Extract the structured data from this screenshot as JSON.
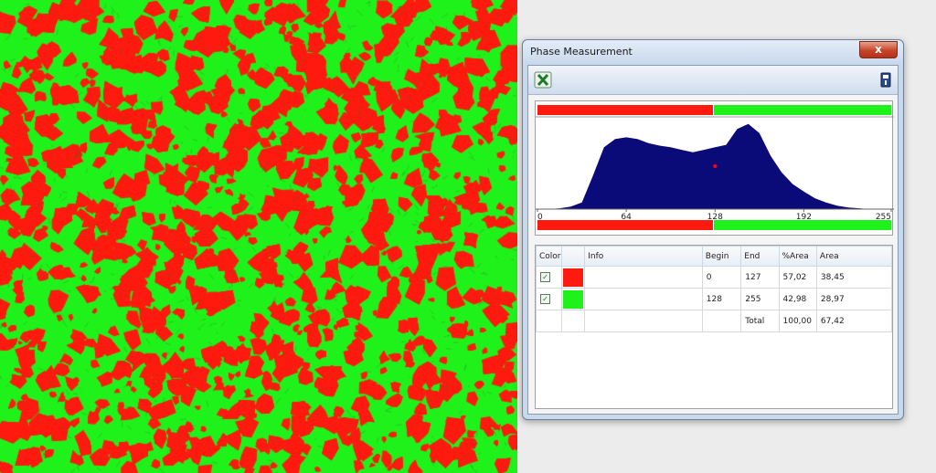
{
  "window": {
    "title": "Phase Measurement",
    "close_glyph": "x",
    "excel_icon": "excel-export-icon",
    "pin_icon": "pin-icon"
  },
  "colors": {
    "phase1": "#ff1a0f",
    "phase2": "#1ff21a",
    "histogram_fill": "#0a0a78",
    "threshold_marker": "#ff0000"
  },
  "chart_data": {
    "type": "area",
    "title": "",
    "xlabel": "",
    "ylabel": "",
    "xlim": [
      0,
      255
    ],
    "xticks": [
      "0",
      "64",
      "128",
      "192",
      "255"
    ],
    "threshold": 128,
    "x": [
      0,
      8,
      16,
      24,
      32,
      40,
      48,
      56,
      64,
      72,
      80,
      88,
      96,
      104,
      112,
      120,
      128,
      136,
      144,
      152,
      160,
      168,
      176,
      184,
      192,
      200,
      208,
      216,
      224,
      232,
      240,
      248,
      255
    ],
    "y": [
      0,
      0,
      1,
      3,
      8,
      40,
      74,
      84,
      86,
      84,
      79,
      76,
      74,
      71,
      68,
      71,
      74,
      77,
      96,
      102,
      91,
      64,
      44,
      30,
      21,
      13,
      8,
      4,
      2,
      1,
      0,
      0,
      0
    ]
  },
  "table": {
    "headers": [
      "Color",
      "Info",
      "Begin",
      "End",
      "%Area",
      "Area"
    ],
    "rows": [
      {
        "checked": "✓",
        "info": "",
        "begin": "0",
        "end": "127",
        "pct": "57,02",
        "area": "38,45"
      },
      {
        "checked": "✓",
        "info": "",
        "begin": "128",
        "end": "255",
        "pct": "42,98",
        "area": "28,97"
      }
    ],
    "total": {
      "label": "Total",
      "pct": "100,00",
      "area": "67,42"
    }
  }
}
